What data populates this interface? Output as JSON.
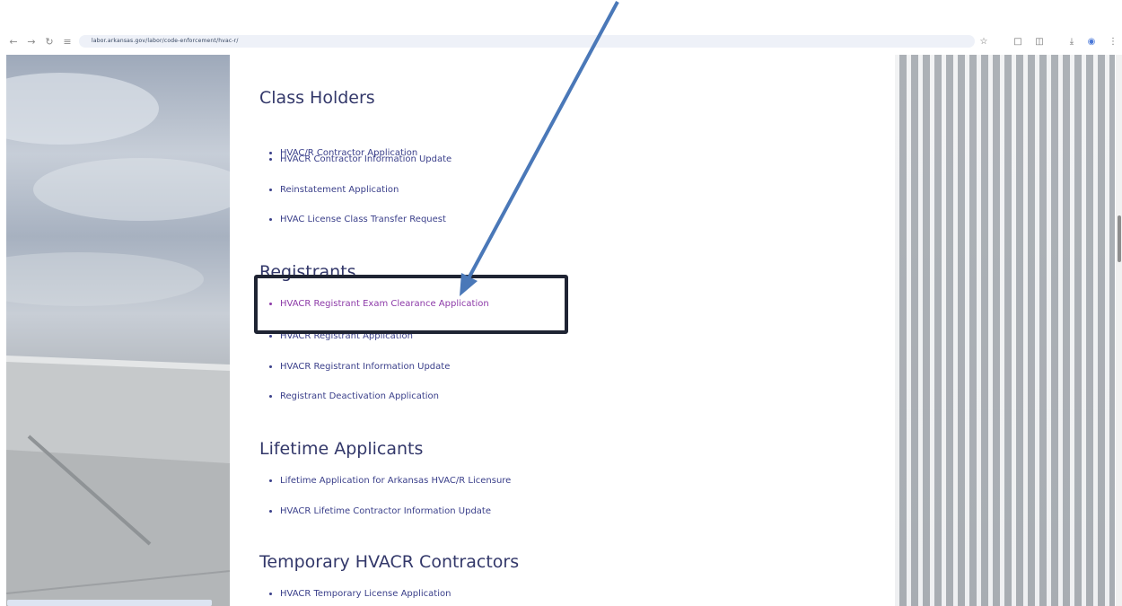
{
  "browser": {
    "url": "labor.arkansas.gov/labor/code-enforcement/hvac-r/"
  },
  "sections": [
    {
      "title": "Class Holders",
      "links": [
        "HVAC/R Contractor Application",
        "HVACR Contractor Information Update",
        "Reinstatement Application",
        "HVAC License Class Transfer Request"
      ]
    },
    {
      "title": "Registrants",
      "links": [
        "HVACR Registrant Exam Clearance Application",
        "HVACR Registrant Application",
        "HVACR Registrant Information Update",
        "Registrant Deactivation Application"
      ]
    },
    {
      "title": "Lifetime Applicants",
      "links": [
        "Lifetime Application for Arkansas HVAC/R Licensure",
        "HVACR Lifetime Contractor Information Update"
      ]
    },
    {
      "title": "Temporary HVACR Contractors",
      "links": [
        "HVACR Temporary License Application"
      ]
    }
  ],
  "colors": {
    "heading": "#33386a",
    "link": "#3a3f8a",
    "visited_link": "#8d3aa8",
    "annotation_arrow": "#4a78b8",
    "annotation_box": "#1f2433"
  }
}
